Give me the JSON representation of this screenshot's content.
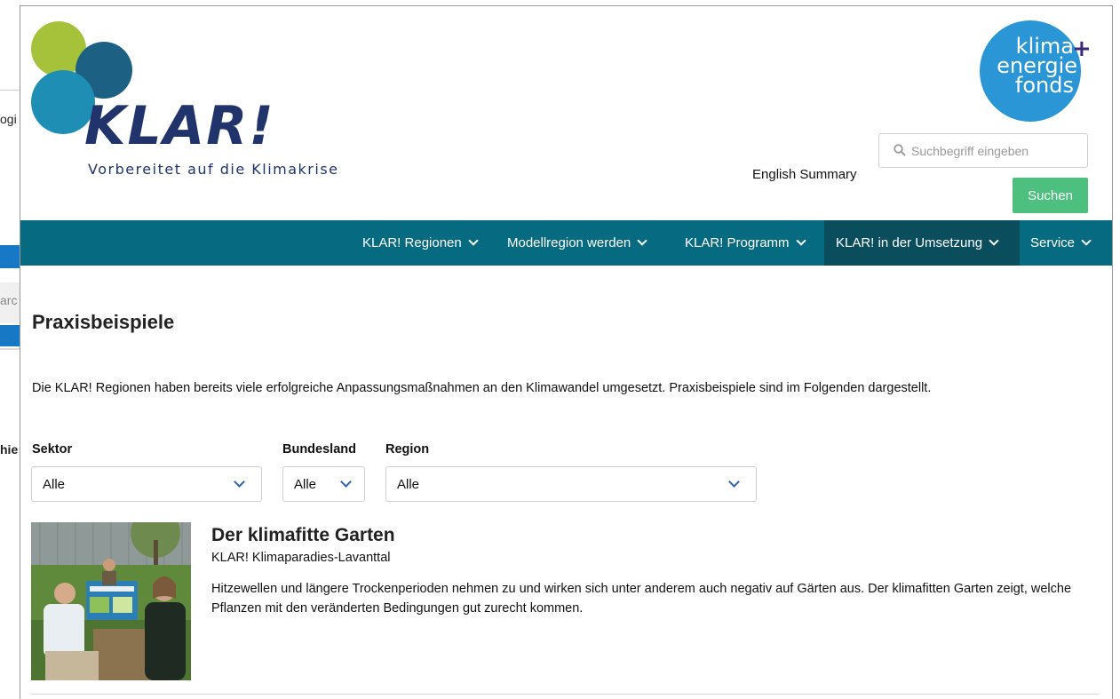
{
  "background_window": {
    "text_line_1": "ogi",
    "search_placeholder": "arc",
    "text_line_2": "hie"
  },
  "header": {
    "logo_word": "KLAR!",
    "tagline": "Vorbereitet auf die Klimakrise",
    "partner_logo": {
      "line1": "klima",
      "line2": "energie",
      "line3": "fonds",
      "plus": "+"
    },
    "english_link": "English Summary",
    "search": {
      "placeholder": "Suchbegriff eingeben",
      "button": "Suchen"
    }
  },
  "nav": {
    "items": [
      {
        "label": "KLAR! Regionen"
      },
      {
        "label": "Modellregion werden"
      },
      {
        "label": "KLAR! Programm"
      },
      {
        "label": "KLAR! in der Umsetzung",
        "active": true
      },
      {
        "label": "Service"
      }
    ]
  },
  "main": {
    "title": "Praxisbeispiele",
    "intro": "Die KLAR! Regionen haben bereits viele erfolgreiche Anpassungsmaßnahmen an den Klimawandel umgesetzt. Praxisbeispiele sind im Folgenden dargestellt.",
    "filters": {
      "sektor": {
        "label": "Sektor",
        "value": "Alle"
      },
      "bundesland": {
        "label": "Bundesland",
        "value": "Alle"
      },
      "region": {
        "label": "Region",
        "value": "Alle"
      }
    },
    "entries": [
      {
        "title": "Der klimafitte Garten",
        "region": "KLAR! Klimaparadies-Lavanttal",
        "description": "Hitzewellen und längere Trockenperioden nehmen zu und wirken sich unter anderem auch negativ auf Gärten aus. Der klimafitten Garten zeigt, welche Pflanzen mit den veränderten Bedingungen gut zurecht kommen."
      }
    ]
  },
  "colors": {
    "nav_bg": "#066a80",
    "nav_active": "#0a4d5d",
    "button_green": "#4dbf7e",
    "logo_navy": "#20336b",
    "partner_blue": "#2a96d6"
  }
}
